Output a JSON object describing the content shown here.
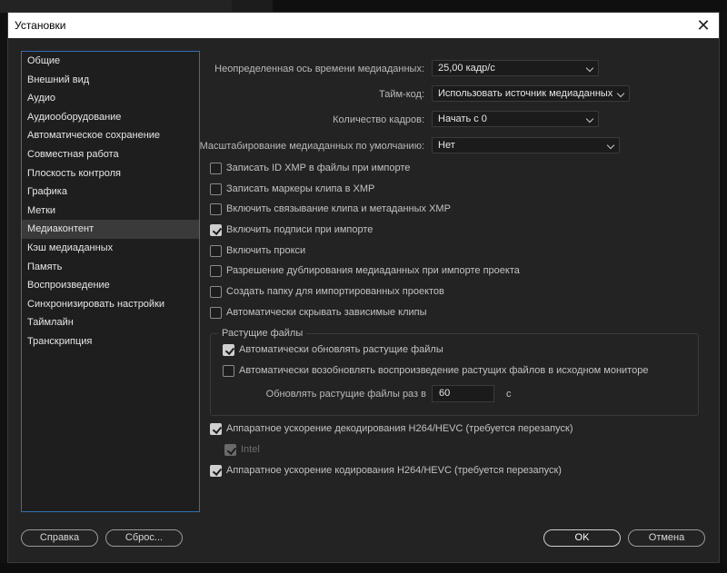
{
  "window": {
    "title": "Установки",
    "close_glyph": "✕"
  },
  "sidebar": {
    "items": [
      "Общие",
      "Внешний вид",
      "Аудио",
      "Аудиооборудование",
      "Автоматическое сохранение",
      "Совместная работа",
      "Плоскость контроля",
      "Графика",
      "Метки",
      "Медиаконтент",
      "Кэш медиаданных",
      "Память",
      "Воспроизведение",
      "Синхронизировать настройки",
      "Таймлайн",
      "Транскрипция"
    ],
    "selected_index": 9
  },
  "fields": {
    "timebase": {
      "label": "Неопределенная ось времени медиаданных:",
      "value": "25,00 кадр/с"
    },
    "timecode": {
      "label": "Тайм-код:",
      "value": "Использовать источник медиаданных"
    },
    "frame_count": {
      "label": "Количество кадров:",
      "value": "Начать с 0"
    },
    "default_scale": {
      "label": "Масштабирование медиаданных по умолчанию:",
      "value": "Нет"
    }
  },
  "checkboxes": [
    {
      "label": "Записать ID XMP в файлы при импорте",
      "checked": false
    },
    {
      "label": "Записать маркеры клипа в XMP",
      "checked": false
    },
    {
      "label": "Включить связывание клипа и метаданных XMP",
      "checked": false
    },
    {
      "label": "Включить подписи при импорте",
      "checked": true
    },
    {
      "label": "Включить прокси",
      "checked": false
    },
    {
      "label": "Разрешение дублирования медиаданных при импорте проекта",
      "checked": false
    },
    {
      "label": "Создать папку для импортированных проектов",
      "checked": false
    },
    {
      "label": "Автоматически скрывать зависимые клипы",
      "checked": false
    }
  ],
  "growing_files": {
    "title": "Растущие файлы",
    "auto_refresh": {
      "label": "Автоматически обновлять растущие файлы",
      "checked": true
    },
    "auto_resume": {
      "label": "Автоматически возобновлять воспроизведение растущих файлов в исходном мониторе",
      "checked": false
    },
    "refresh_interval": {
      "label": "Обновлять растущие файлы раз в",
      "value": "60",
      "unit": "с"
    }
  },
  "hardware": {
    "decode": {
      "label": "Аппаратное ускорение декодирования H264/HEVC (требуется перезапуск)",
      "checked": true
    },
    "intel": {
      "label": "Intel",
      "checked": true,
      "disabled": true
    },
    "encode": {
      "label": "Аппаратное ускорение кодирования H264/HEVC (требуется перезапуск)",
      "checked": true
    }
  },
  "buttons": {
    "help": "Справка",
    "reset": "Сброс...",
    "ok": "OK",
    "cancel": "Отмена"
  }
}
